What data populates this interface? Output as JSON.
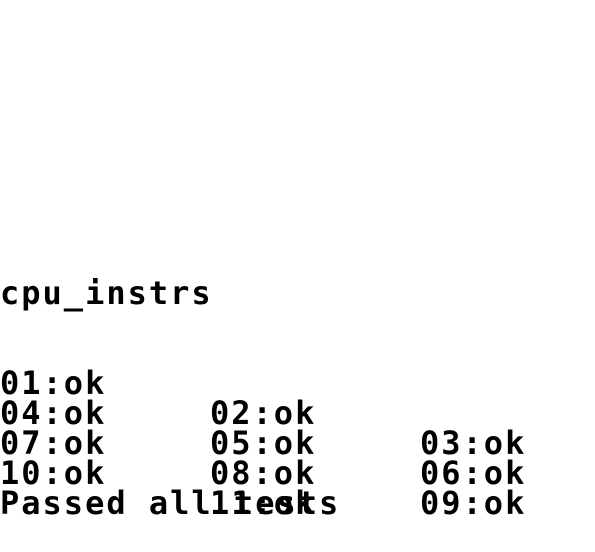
{
  "screen": {
    "title": "cpu_instrs",
    "results": [
      [
        "01:ok",
        "02:ok",
        "03:ok"
      ],
      [
        "04:ok",
        "05:ok",
        "06:ok"
      ],
      [
        "07:ok",
        "08:ok",
        "09:ok"
      ],
      [
        "10:ok",
        "11:ok"
      ]
    ],
    "summary": "Passed all tests"
  },
  "colors": {
    "background": "#ffffff",
    "text": "#000000"
  }
}
